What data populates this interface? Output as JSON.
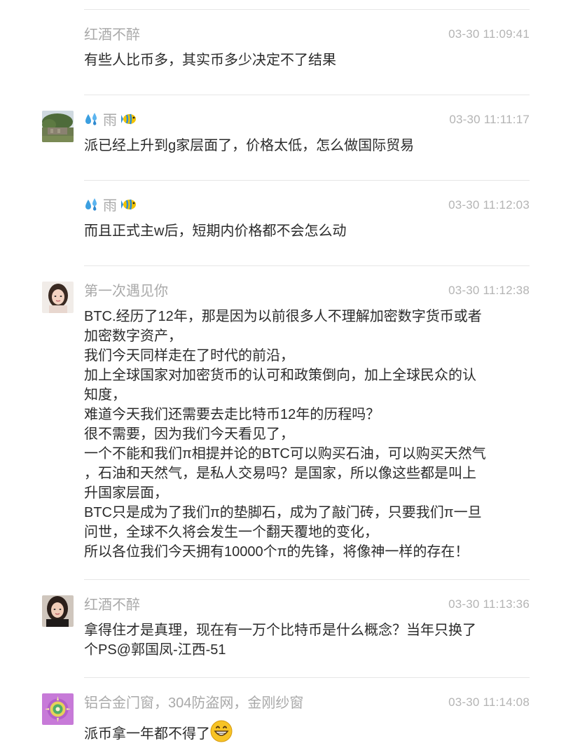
{
  "comments": [
    {
      "username": "红酒不醉",
      "time": "03-30 11:09:41",
      "lines": [
        "有些人比币多，其实币多少决定不了结果"
      ]
    },
    {
      "username": "雨",
      "username_prefix_icon": "sweat-droplets-icon",
      "username_suffix_icon": "tropical-fish-icon",
      "time": "03-30 11:11:17",
      "lines": [
        "派已经上升到g家层面了，价格太低，怎么做国际贸易"
      ]
    },
    {
      "username": "雨",
      "username_prefix_icon": "sweat-droplets-icon",
      "username_suffix_icon": "tropical-fish-icon",
      "time": "03-30 11:12:03",
      "lines": [
        "而且正式主w后，短期内价格都不会怎么动"
      ]
    },
    {
      "username": "第一次遇见你",
      "time": "03-30 11:12:38",
      "lines": [
        "BTC.经历了12年，那是因为以前很多人不理解加密数字货币或者",
        "加密数字资产，",
        "我们今天同样走在了时代的前沿，",
        "加上全球国家对加密货币的认可和政策倒向，加上全球民众的认",
        "知度，",
        "难道今天我们还需要去走比特币12年的历程吗？",
        "很不需要，因为我们今天看见了，",
        "一个不能和我们π相提并论的BTC可以购买石油，可以购买天然气",
        "，石油和天然气，是私人交易吗？是国家，所以像这些都是叫上",
        "升国家层面，",
        "BTC只是成为了我们π的垫脚石，成为了敲门砖，只要我们π一旦",
        "问世，全球不久将会发生一个翻天覆地的变化，",
        "所以各位我们今天拥有10000个π的先锋，将像神一样的存在！"
      ]
    },
    {
      "username": "红酒不醉",
      "time": "03-30 11:13:36",
      "lines": [
        "拿得住才是真理，现在有一万个比特币是什么概念？当年只换了",
        "个PS@郭国凤-江西-51"
      ]
    },
    {
      "username": "铝合金门窗，304防盗网，金刚纱窗",
      "time": "03-30 11:14:08",
      "lines": [
        "派币拿一年都不得了"
      ],
      "trailing_icon": "grinning-face-icon"
    }
  ]
}
